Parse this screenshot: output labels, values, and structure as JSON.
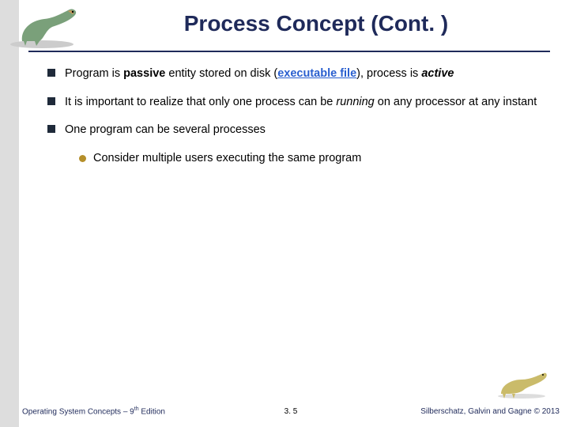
{
  "title": "Process Concept (Cont. )",
  "bullets": {
    "b1_a": "Program is ",
    "b1_passive": "passive",
    "b1_b": " entity stored on disk (",
    "b1_link": "executable file",
    "b1_c": "), process is ",
    "b1_active": "active",
    "b2_a": "It is important to realize that only one process can be ",
    "b2_running": "running",
    "b2_b": " on any processor at any instant",
    "b3": "One program can be several processes",
    "b3_sub": "Consider multiple users executing the same program"
  },
  "footer": {
    "left_a": "Operating System Concepts – 9",
    "left_sup": "th",
    "left_b": " Edition",
    "center": "3. 5",
    "right": "Silberschatz, Galvin and Gagne © 2013"
  }
}
